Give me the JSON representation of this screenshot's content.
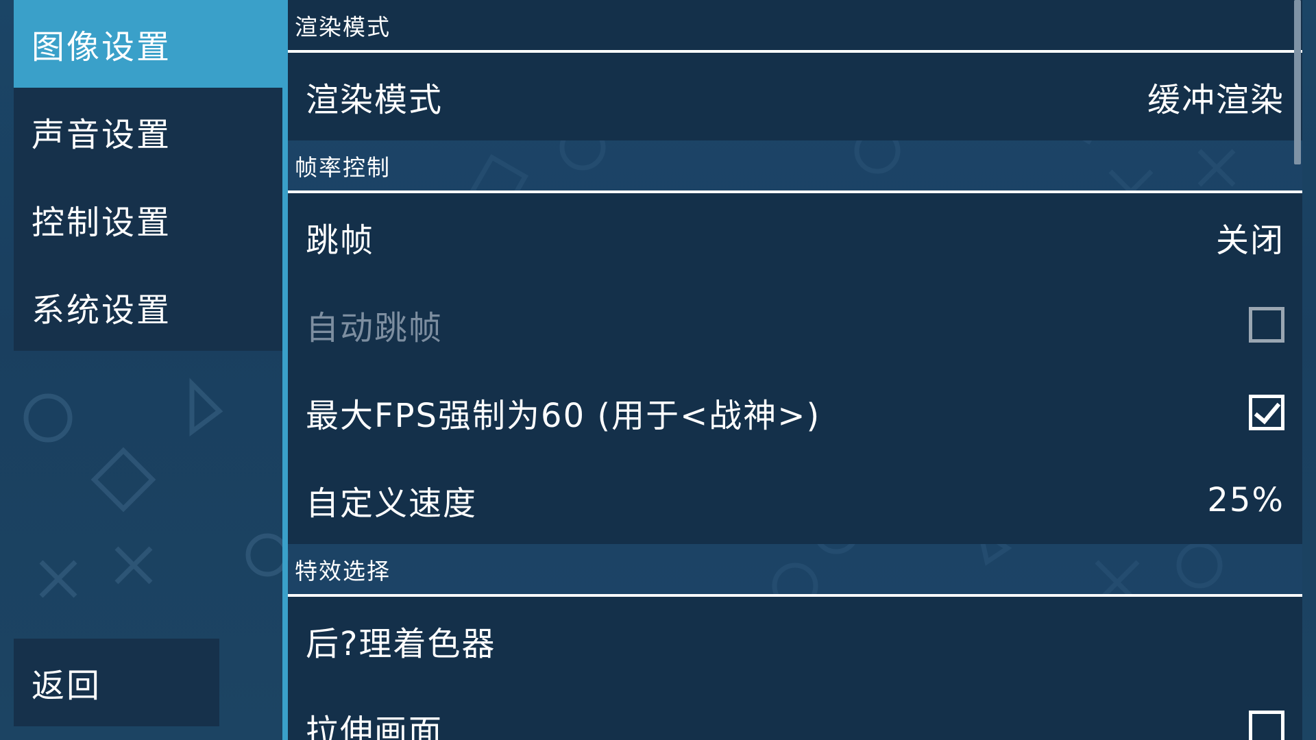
{
  "sidebar": {
    "items": [
      {
        "label": "图像设置",
        "active": true
      },
      {
        "label": "声音设置",
        "active": false
      },
      {
        "label": "控制设置",
        "active": false
      },
      {
        "label": "系统设置",
        "active": false
      }
    ],
    "back_label": "返回"
  },
  "settings": {
    "render_section": {
      "header": "渲染模式",
      "render_mode_label": "渲染模式",
      "render_mode_value": "缓冲渲染"
    },
    "framerate_section": {
      "header": "帧率控制",
      "frameskip_label": "跳帧",
      "frameskip_value": "关闭",
      "auto_frameskip_label": "自动跳帧",
      "auto_frameskip_checked": false,
      "max_fps_label": "最大FPS强制为60 (用于<战神>)",
      "max_fps_checked": true,
      "custom_speed_label": "自定义速度",
      "custom_speed_value": "25%"
    },
    "effects_section": {
      "header": "特效选择",
      "postprocess_shader_label": "后?理着色器",
      "stretch_label": "拉伸画面",
      "stretch_checked": false
    }
  },
  "colors": {
    "accent": "#3aa0c9",
    "panel": "#14304a",
    "background": "#1b4566"
  }
}
